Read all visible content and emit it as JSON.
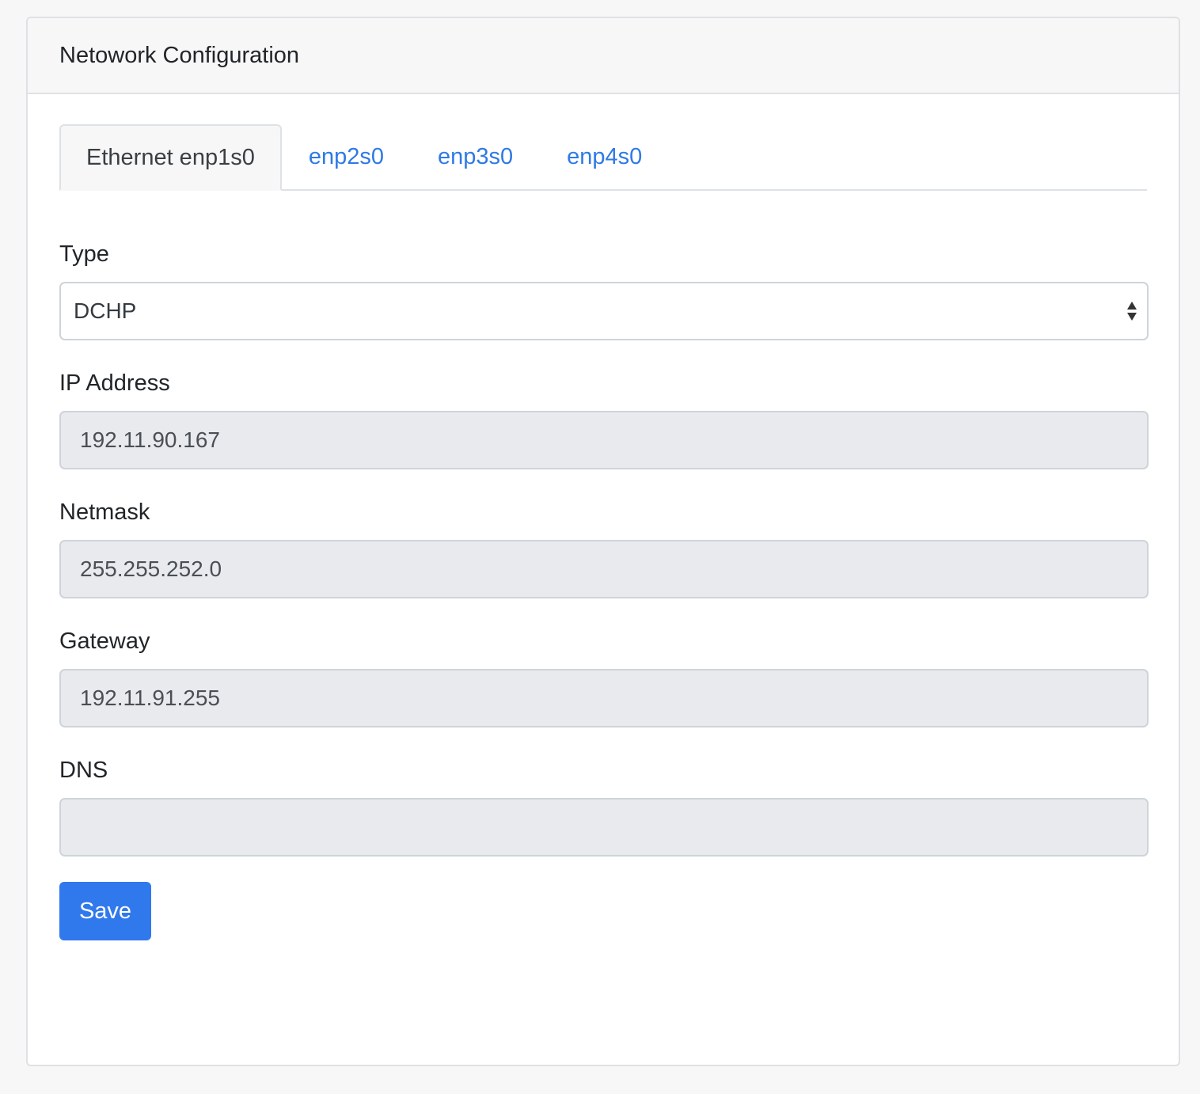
{
  "card": {
    "title": "Netowork Configuration"
  },
  "tabs": [
    {
      "label": "Ethernet enp1s0",
      "active": true
    },
    {
      "label": "enp2s0",
      "active": false
    },
    {
      "label": "enp3s0",
      "active": false
    },
    {
      "label": "enp4s0",
      "active": false
    }
  ],
  "form": {
    "type": {
      "label": "Type",
      "value": "DCHP"
    },
    "ip_address": {
      "label": "IP Address",
      "value": "192.11.90.167"
    },
    "netmask": {
      "label": "Netmask",
      "value": "255.255.252.0"
    },
    "gateway": {
      "label": "Gateway",
      "value": "192.11.91.255"
    },
    "dns": {
      "label": "DNS",
      "value": ""
    },
    "save_label": "Save"
  },
  "colors": {
    "accent": "#3079ed",
    "link": "#2f7ae5",
    "readonly_bg": "#e9eaed"
  },
  "icons": {
    "select_arrows": "sort-arrows-icon"
  }
}
